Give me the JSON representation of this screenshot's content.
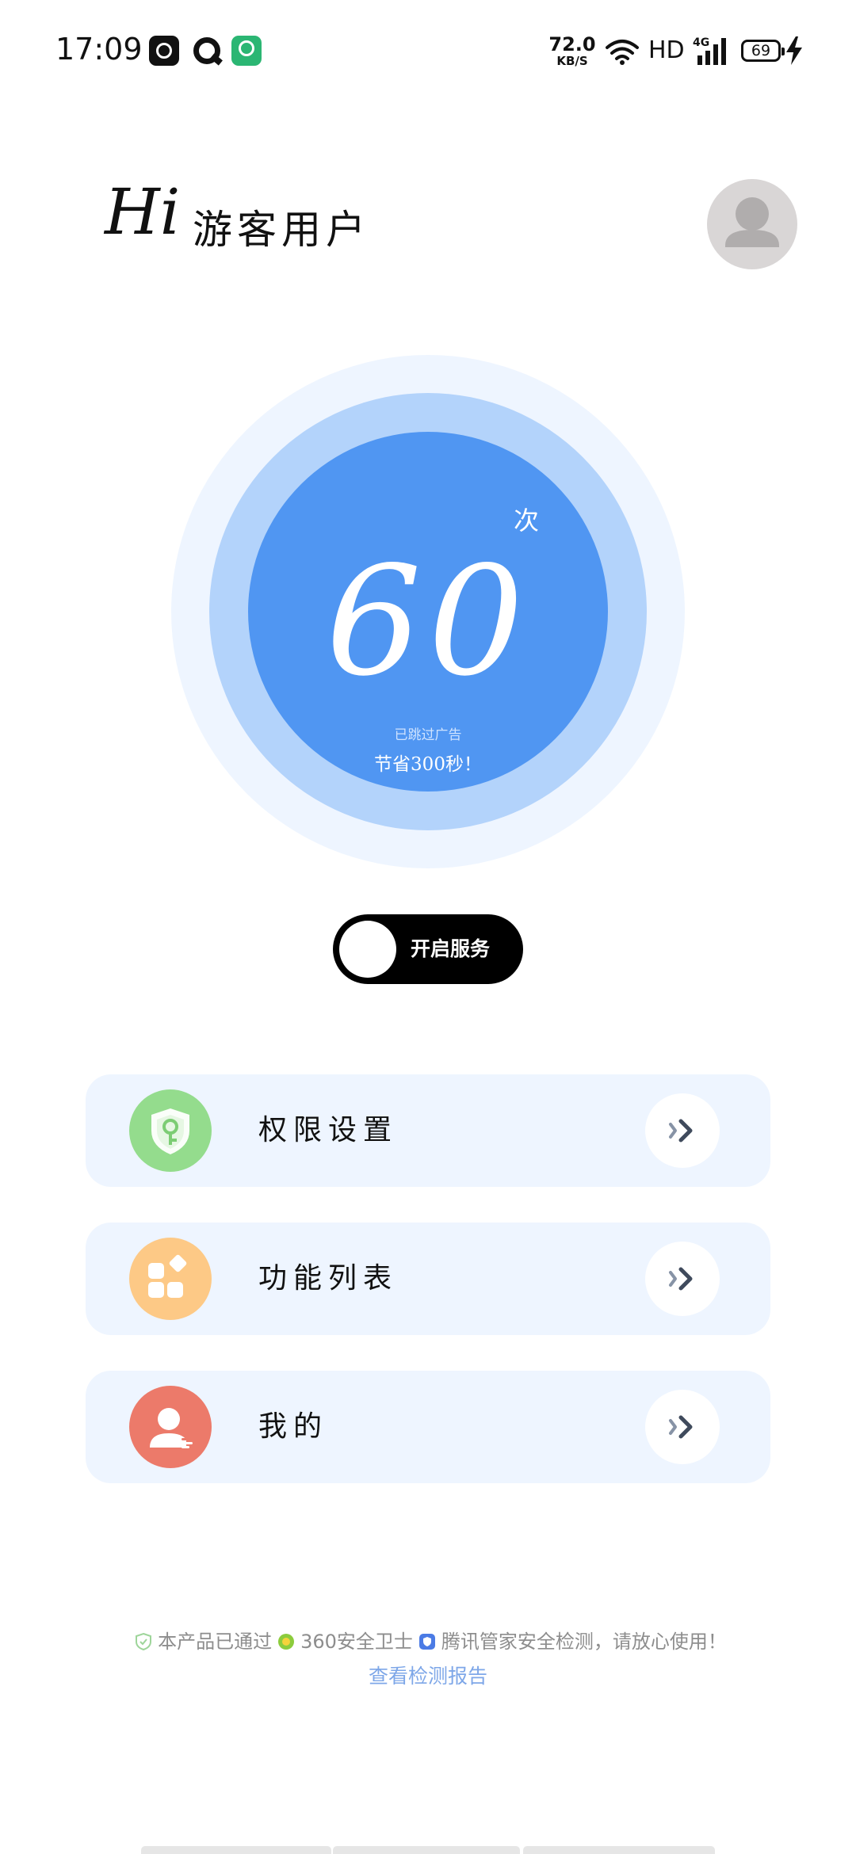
{
  "status_bar": {
    "time": "17:09",
    "net_speed_value": "72.0",
    "net_speed_unit": "KB/S",
    "hd_label": "HD",
    "network_type": "4G",
    "battery_level": "69",
    "app_icons": [
      "kuaishou-app-icon",
      "qq-browser-app-icon",
      "green-app-icon"
    ]
  },
  "greeting": {
    "hi": "Hi",
    "username": "游客用户"
  },
  "counter": {
    "value": "60",
    "unit": "次",
    "description": "已跳过广告",
    "saved": "节省300秒！"
  },
  "service_toggle": {
    "label": "开启服务",
    "enabled": false
  },
  "menu": {
    "items": [
      {
        "label": "权限设置",
        "icon": "shield-key-icon",
        "color": "#94dc8d"
      },
      {
        "label": "功能列表",
        "icon": "app-grid-icon",
        "color": "#fdc986"
      },
      {
        "label": "我的",
        "icon": "user-profile-icon",
        "color": "#ec7a6a"
      }
    ]
  },
  "footer": {
    "security_text_1": "本产品已通过",
    "security_text_2": "360安全卫士",
    "security_text_3": "腾讯管家安全检测，请放心使用！",
    "report_link": "查看检测报告"
  },
  "colors": {
    "accent_blue": "#5096f2",
    "ring_light": "#b3d3fb",
    "ring_lighter": "#eef5ff",
    "card_bg": "#eef5ff"
  }
}
